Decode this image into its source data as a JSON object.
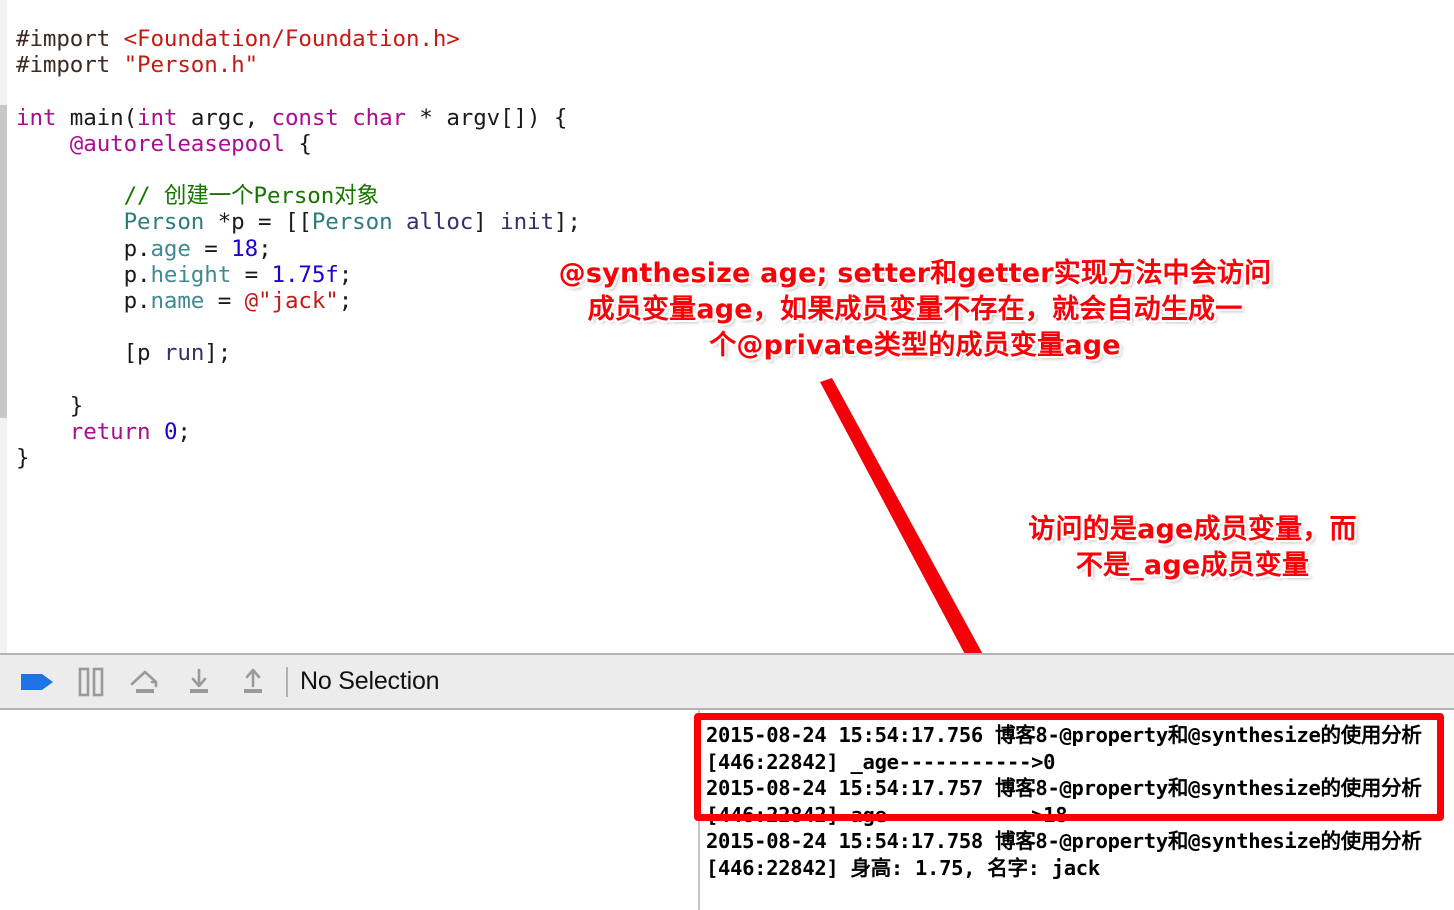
{
  "editor": {
    "code_lines": [
      [
        {
          "t": "#import ",
          "c": "pre"
        },
        {
          "t": "<Foundation/Foundation.h>",
          "c": "str"
        }
      ],
      [
        {
          "t": "#import ",
          "c": "pre"
        },
        {
          "t": "\"Person.h\"",
          "c": "str"
        }
      ],
      [],
      [
        {
          "t": "int",
          "c": "kw"
        },
        {
          "t": " main(",
          "c": "plain"
        },
        {
          "t": "int",
          "c": "kw"
        },
        {
          "t": " argc, ",
          "c": "plain"
        },
        {
          "t": "const",
          "c": "kw"
        },
        {
          "t": " ",
          "c": "plain"
        },
        {
          "t": "char",
          "c": "kw"
        },
        {
          "t": " * argv[]) {",
          "c": "plain"
        }
      ],
      [
        {
          "t": "    ",
          "c": "plain"
        },
        {
          "t": "@autoreleasepool",
          "c": "kw"
        },
        {
          "t": " {",
          "c": "plain"
        }
      ],
      [],
      [
        {
          "t": "        ",
          "c": "plain"
        },
        {
          "t": "// 创建一个Person对象",
          "c": "cmt"
        }
      ],
      [
        {
          "t": "        ",
          "c": "plain"
        },
        {
          "t": "Person",
          "c": "cls"
        },
        {
          "t": " *p = [[",
          "c": "plain"
        },
        {
          "t": "Person",
          "c": "cls"
        },
        {
          "t": " ",
          "c": "plain"
        },
        {
          "t": "alloc",
          "c": "meth"
        },
        {
          "t": "] ",
          "c": "plain"
        },
        {
          "t": "init",
          "c": "meth"
        },
        {
          "t": "];",
          "c": "plain"
        }
      ],
      [
        {
          "t": "        p.",
          "c": "plain"
        },
        {
          "t": "age",
          "c": "prop"
        },
        {
          "t": " = ",
          "c": "plain"
        },
        {
          "t": "18",
          "c": "num"
        },
        {
          "t": ";",
          "c": "plain"
        }
      ],
      [
        {
          "t": "        p.",
          "c": "plain"
        },
        {
          "t": "height",
          "c": "prop"
        },
        {
          "t": " = ",
          "c": "plain"
        },
        {
          "t": "1.75f",
          "c": "num"
        },
        {
          "t": ";",
          "c": "plain"
        }
      ],
      [
        {
          "t": "        p.",
          "c": "plain"
        },
        {
          "t": "name",
          "c": "prop"
        },
        {
          "t": " = ",
          "c": "plain"
        },
        {
          "t": "@\"jack\"",
          "c": "str"
        },
        {
          "t": ";",
          "c": "plain"
        }
      ],
      [],
      [
        {
          "t": "        [p ",
          "c": "plain"
        },
        {
          "t": "run",
          "c": "meth"
        },
        {
          "t": "];",
          "c": "plain"
        }
      ],
      [],
      [
        {
          "t": "    }",
          "c": "plain"
        }
      ],
      [
        {
          "t": "    ",
          "c": "plain"
        },
        {
          "t": "return",
          "c": "kw"
        },
        {
          "t": " ",
          "c": "plain"
        },
        {
          "t": "0",
          "c": "num"
        },
        {
          "t": ";",
          "c": "plain"
        }
      ],
      [
        {
          "t": "}",
          "c": "plain"
        }
      ]
    ]
  },
  "annotations": {
    "note_1": "@synthesize age; setter和getter实现方法中会访问\n成员变量age，如果成员变量不存在，就会自动生成一\n个@private类型的成员变量age",
    "note_2": "访问的是age成员变量，而\n不是_age成员变量",
    "arrow_color": "#f40008",
    "text_color": "#fb0007"
  },
  "debug_bar": {
    "buttons": [
      {
        "name": "continue-button",
        "icon": "continue-flag-icon",
        "label": "Continue"
      },
      {
        "name": "pause-button",
        "icon": "pause-icon",
        "label": "Pause"
      },
      {
        "name": "step-over-button",
        "icon": "step-over-icon",
        "label": "Step Over"
      },
      {
        "name": "step-into-button",
        "icon": "step-into-icon",
        "label": "Step Into"
      },
      {
        "name": "step-out-button",
        "icon": "step-out-icon",
        "label": "Step Out"
      }
    ],
    "selection_label": "No Selection",
    "accent_color": "#1f72e8"
  },
  "console": {
    "lines": [
      "2015-08-24 15:54:17.756 博客8-@property和@synthesize的使用分析[446:22842] _age----------->0",
      "2015-08-24 15:54:17.757 博客8-@property和@synthesize的使用分析[446:22842] age------------>18",
      "2015-08-24 15:54:17.758 博客8-@property和@synthesize的使用分析[446:22842] 身高: 1.75, 名字: jack"
    ],
    "highlight_color": "#fb0007"
  }
}
